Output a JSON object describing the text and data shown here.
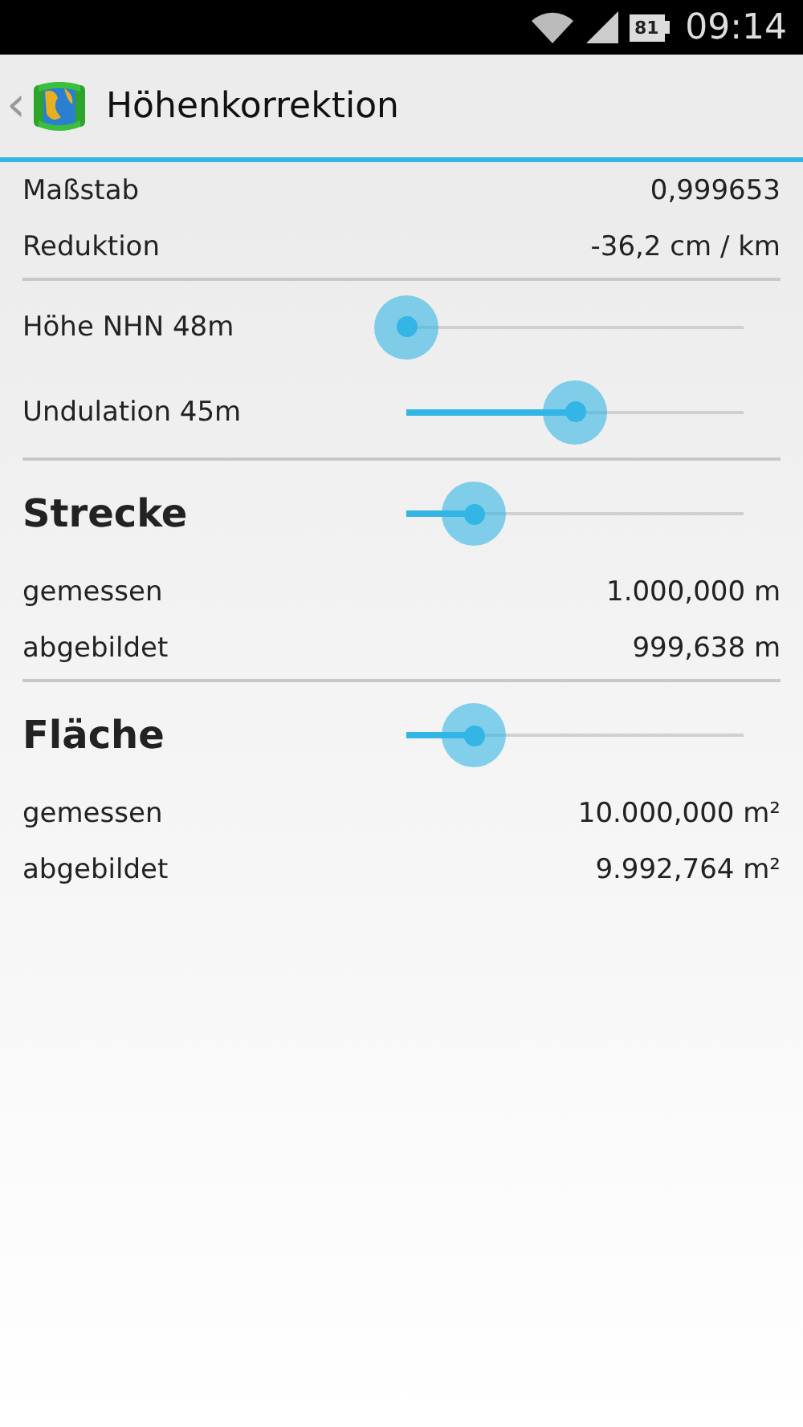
{
  "status_bar": {
    "battery": "81",
    "time": "09:14"
  },
  "app_bar": {
    "back": "‹",
    "title": "Höhenkorrektion"
  },
  "items": [
    {
      "kind": "value",
      "label": "Maßstab",
      "value": "0,999653"
    },
    {
      "kind": "value",
      "label": "Reduktion",
      "value": "-36,2 cm / km"
    },
    {
      "kind": "divider"
    },
    {
      "kind": "slider",
      "label": "Höhe NHN 48m"
    },
    {
      "kind": "slider",
      "label": "Undulation 45m",
      "level": 0.5
    },
    {
      "kind": "divider"
    },
    {
      "kind": "heading",
      "label": "Strecke",
      "level": 0.2
    },
    {
      "kind": "value",
      "label": "gemessen",
      "value": "1.000,000 m"
    },
    {
      "kind": "value",
      "label": "abgebildet",
      "value": "999,638 m"
    },
    {
      "kind": "divider"
    },
    {
      "kind": "heading",
      "label": "Fläche",
      "level": 0.2
    },
    {
      "kind": "value",
      "label": "gemessen",
      "value": "10.000,000 m²"
    },
    {
      "kind": "value",
      "label": "abgebildet",
      "value": "9.992,764 m²"
    }
  ]
}
